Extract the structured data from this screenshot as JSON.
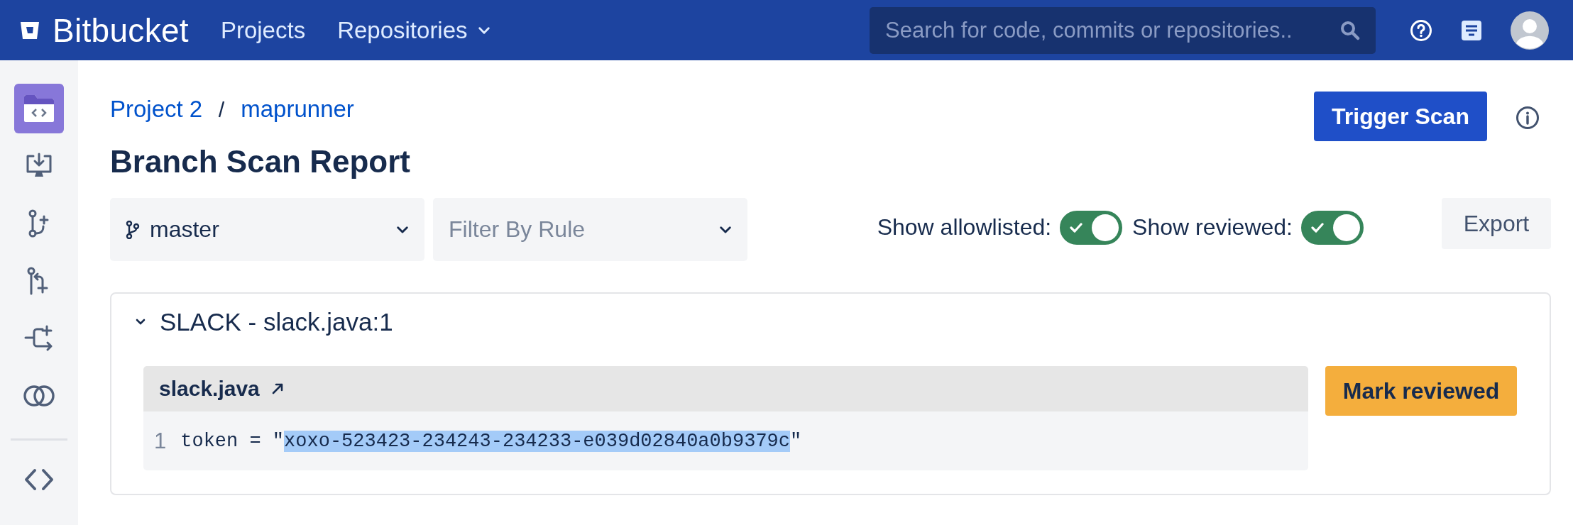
{
  "header": {
    "product": "Bitbucket",
    "nav": [
      {
        "label": "Projects",
        "has_menu": false
      },
      {
        "label": "Repositories",
        "has_menu": true
      }
    ],
    "search": {
      "placeholder": "Search for code, commits or repositories.."
    }
  },
  "sidebar": {
    "items": [
      {
        "kind": "source",
        "selected": true
      },
      {
        "kind": "clone",
        "selected": false
      },
      {
        "kind": "branch",
        "selected": false
      },
      {
        "kind": "pull-request",
        "selected": false
      },
      {
        "kind": "fork",
        "selected": false
      },
      {
        "kind": "compare",
        "selected": false
      }
    ],
    "footer_items": [
      {
        "kind": "code",
        "selected": false
      }
    ]
  },
  "breadcrumb": [
    "Project 2",
    "maprunner"
  ],
  "title": "Branch Scan Report",
  "trigger_button": "Trigger Scan",
  "branch_select": {
    "value": "master"
  },
  "rule_select": {
    "placeholder": "Filter By Rule"
  },
  "toggles": [
    {
      "label": "Show allowlisted:",
      "on": true
    },
    {
      "label": "Show reviewed:",
      "on": true
    }
  ],
  "export_button": "Export",
  "findings": [
    {
      "title": "SLACK - slack.java:1",
      "expanded": true,
      "file": "slack.java",
      "line_number": "1",
      "code_before": "token = \"",
      "code_selected": "xoxo-523423-234243-234233-e039d02840a0b9379c",
      "code_after": "\"",
      "action": "Mark reviewed"
    }
  ]
}
